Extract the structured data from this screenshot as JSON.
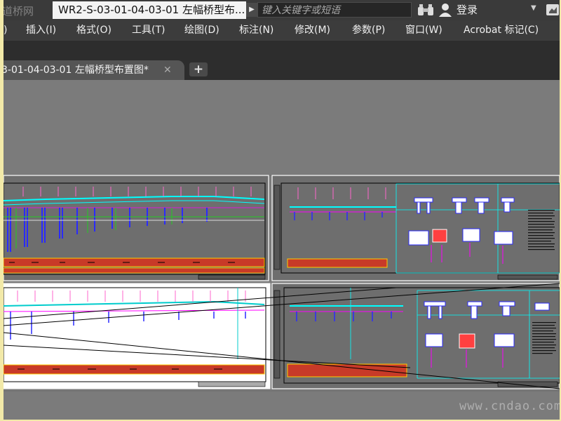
{
  "window": {
    "logo_text": "道桥网",
    "document_title": "WR2-S-03-01-04-03-01 左幅桥型布...",
    "search_placeholder": "键入关键字或短语",
    "login_label": "登录"
  },
  "menu": {
    "items": [
      ")",
      "插入(I)",
      "格式(O)",
      "工具(T)",
      "绘图(D)",
      "标注(N)",
      "修改(M)",
      "参数(P)",
      "窗口(W)",
      "Acrobat 标记(C)"
    ]
  },
  "tabs": {
    "active_label": "3-01-04-03-01 左幅桥型布置图*",
    "close_glyph": "✕",
    "add_glyph": "+"
  },
  "icons": {
    "search_dropdown": "play-arrow-icon",
    "binoculars": "binoculars-icon",
    "user": "user-icon",
    "help": "help-icon"
  },
  "colors": {
    "canvas_bg": "#7b7b7b",
    "menu_bg": "#3c3c3c",
    "title_bg": "#3a3a3a",
    "sheet_border": "#ffffff",
    "accent_cyan": "#00ffff",
    "accent_magenta": "#ff00ff",
    "accent_blue": "#1a1aff",
    "accent_red": "#ff2a2a"
  },
  "watermark": {
    "text": "www.cndao.com"
  }
}
